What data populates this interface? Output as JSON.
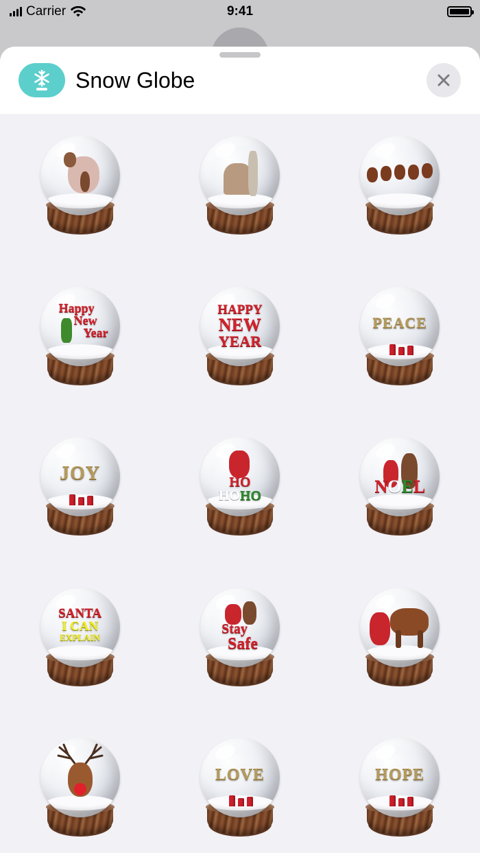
{
  "status_bar": {
    "carrier": "Carrier",
    "time": "9:41"
  },
  "header": {
    "app_title": "Snow Globe",
    "app_icon": "snowflake-icon",
    "close_icon": "close-icon"
  },
  "stickers": [
    {
      "name": "globe-reindeer-family",
      "texts": []
    },
    {
      "name": "globe-nutcracker",
      "texts": []
    },
    {
      "name": "globe-sleigh-reindeer",
      "texts": []
    },
    {
      "name": "globe-happy-new-year-elf",
      "texts": [
        "Happy",
        "New",
        "Year"
      ]
    },
    {
      "name": "globe-happy-new-year",
      "texts": [
        "HAPPY",
        "NEW",
        "YEAR"
      ]
    },
    {
      "name": "globe-peace",
      "texts": [
        "PEACE"
      ]
    },
    {
      "name": "globe-joy",
      "texts": [
        "JOY"
      ]
    },
    {
      "name": "globe-santa-ho-ho",
      "texts": [
        "HO",
        "HO",
        "HO"
      ]
    },
    {
      "name": "globe-noel",
      "texts": [
        "N",
        "O",
        "E",
        "L"
      ]
    },
    {
      "name": "globe-santa-i-can-explain",
      "texts": [
        "SANTA",
        "I CAN",
        "EXPLAIN"
      ]
    },
    {
      "name": "globe-stay-safe",
      "texts": [
        "Stay",
        "Safe"
      ]
    },
    {
      "name": "globe-santa-and-reindeer",
      "texts": []
    },
    {
      "name": "globe-rudolph",
      "texts": []
    },
    {
      "name": "globe-love",
      "texts": [
        "LOVE"
      ]
    },
    {
      "name": "globe-hope",
      "texts": [
        "HOPE"
      ]
    }
  ]
}
